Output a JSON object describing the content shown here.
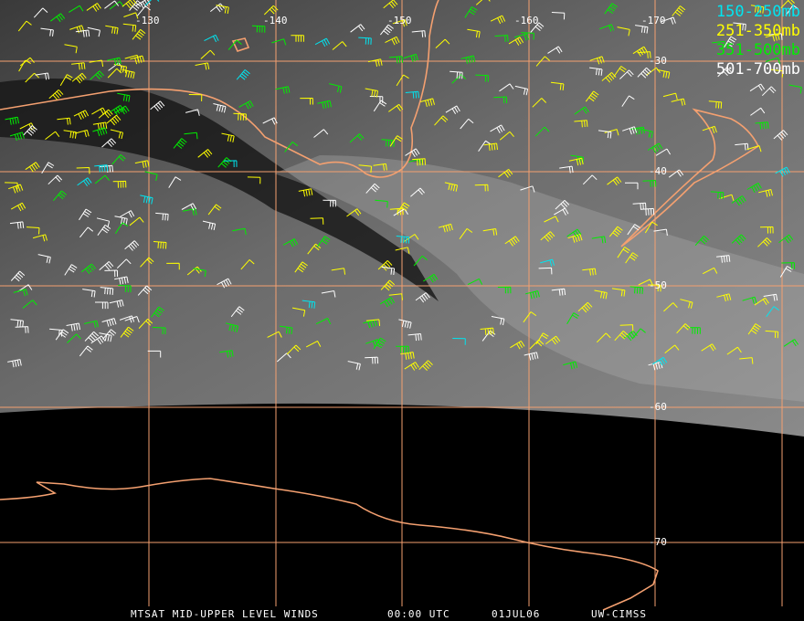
{
  "map": {
    "caption": {
      "title": "MTSAT MID-UPPER LEVEL WINDS",
      "time": "00:00 UTC",
      "date": "01JUL06",
      "source": "UW-CIMSS"
    },
    "legend": [
      {
        "label": "150-250mb",
        "color": "#00e5f0"
      },
      {
        "label": "251-350mb",
        "color": "#ffff00"
      },
      {
        "label": "351-500mb",
        "color": "#00ee00"
      },
      {
        "label": "501-700mb",
        "color": "#ffffff"
      }
    ],
    "longitude_labels": [
      "-130",
      "-140",
      "-150",
      "-160",
      "-170"
    ],
    "latitude_labels": [
      "-30",
      "-40",
      "-50",
      "-60",
      "-70"
    ],
    "grid_color": "#f4a070",
    "coast_color": "#f4a070"
  }
}
